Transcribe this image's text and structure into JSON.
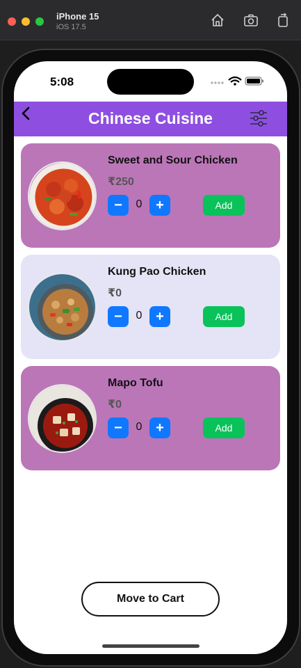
{
  "simulator": {
    "device_name": "iPhone 15",
    "os_version": "iOS 17.5"
  },
  "status_bar": {
    "time": "5:08"
  },
  "header": {
    "title": "Chinese Cuisine",
    "background_color": "#8e4fe0"
  },
  "items": [
    {
      "name": "Sweet and Sour Chicken",
      "price": "₹250",
      "quantity": "0",
      "add_label": "Add",
      "card_color": "#bb76b8",
      "image": "sweet-sour-chicken-photo"
    },
    {
      "name": "Kung Pao Chicken",
      "price": "₹0",
      "quantity": "0",
      "add_label": "Add",
      "card_color": "#e5e4f6",
      "image": "kung-pao-chicken-photo"
    },
    {
      "name": "Mapo Tofu",
      "price": "₹0",
      "quantity": "0",
      "add_label": "Add",
      "card_color": "#bb76b8",
      "image": "mapo-tofu-photo"
    }
  ],
  "cart_button": {
    "label": "Move to Cart"
  },
  "colors": {
    "stepper": "#1078ff",
    "add": "#0ac25a"
  }
}
